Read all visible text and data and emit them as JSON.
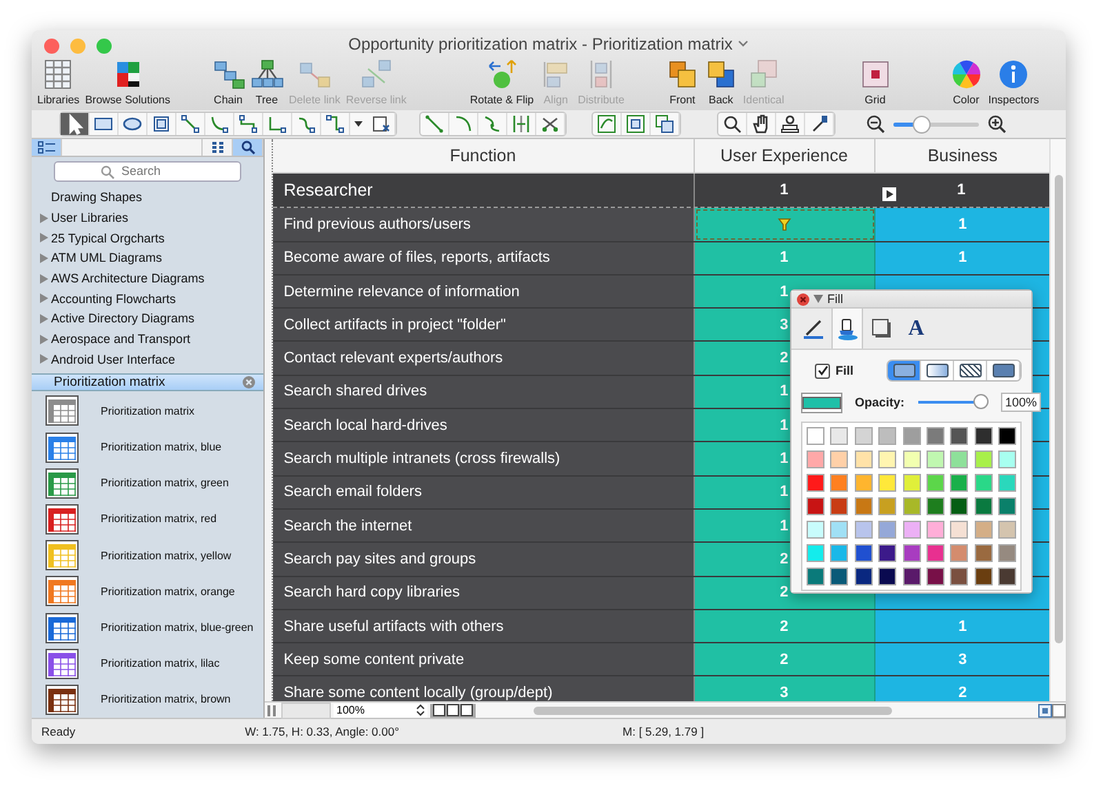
{
  "window": {
    "title": "Opportunity prioritization matrix - Prioritization matrix"
  },
  "toolbar": [
    [
      {
        "label": "Libraries",
        "disabled": false
      },
      {
        "label": "Browse Solutions",
        "disabled": false
      }
    ],
    [
      {
        "label": "Chain",
        "disabled": false
      },
      {
        "label": "Tree",
        "disabled": false
      },
      {
        "label": "Delete link",
        "disabled": true
      },
      {
        "label": "Reverse link",
        "disabled": true
      }
    ],
    [
      {
        "label": "Rotate & Flip",
        "disabled": false
      },
      {
        "label": "Align",
        "disabled": true
      },
      {
        "label": "Distribute",
        "disabled": true
      }
    ],
    [
      {
        "label": "Front",
        "disabled": false
      },
      {
        "label": "Back",
        "disabled": false
      },
      {
        "label": "Identical",
        "disabled": true
      }
    ],
    [
      {
        "label": "Grid",
        "disabled": false
      }
    ],
    [
      {
        "label": "Color",
        "disabled": false
      },
      {
        "label": "Inspectors",
        "disabled": false
      }
    ]
  ],
  "tool_groups": [
    [
      {
        "selected": true
      },
      {
        "selected": false
      },
      {
        "selected": false
      },
      {
        "selected": false
      },
      {
        "selected": false
      },
      {
        "selected": false
      },
      {
        "selected": false
      },
      {
        "selected": false
      },
      {
        "selected": false
      },
      {
        "selected": false
      },
      {
        "selected": false
      }
    ],
    [
      {
        "selected": false
      },
      {
        "selected": false
      },
      {
        "selected": false
      },
      {
        "selected": false
      },
      {
        "selected": false
      }
    ],
    [
      {
        "selected": false
      },
      {
        "selected": false
      },
      {
        "selected": false
      }
    ],
    [
      {
        "selected": false
      },
      {
        "selected": false
      },
      {
        "selected": false
      },
      {
        "selected": false
      }
    ]
  ],
  "zoom_slider": {
    "level": 0.33
  },
  "sidebar": {
    "view_buttons": [
      {
        "selected": true
      },
      {
        "selected": false
      },
      {
        "selected": true
      }
    ],
    "search": {
      "placeholder": "Search"
    },
    "libraries": [
      {
        "label": "Drawing Shapes",
        "expandable": false
      },
      {
        "label": "User Libraries",
        "expandable": true
      },
      {
        "label": "25 Typical Orgcharts",
        "expandable": true
      },
      {
        "label": "ATM UML Diagrams",
        "expandable": true
      },
      {
        "label": "AWS Architecture Diagrams",
        "expandable": true
      },
      {
        "label": "Accounting Flowcharts",
        "expandable": true
      },
      {
        "label": "Active Directory Diagrams",
        "expandable": true
      },
      {
        "label": "Aerospace and Transport",
        "expandable": true
      },
      {
        "label": "Android User Interface",
        "expandable": true
      }
    ],
    "open_library": {
      "title": "Prioritization matrix"
    },
    "shapes": [
      {
        "label": "Prioritization matrix",
        "color": "#8c8c8c"
      },
      {
        "label": "Prioritization matrix, blue",
        "color": "#2a80e8"
      },
      {
        "label": "Prioritization matrix, green",
        "color": "#2a9a48"
      },
      {
        "label": "Prioritization matrix, red",
        "color": "#d82020"
      },
      {
        "label": "Prioritization matrix, yellow",
        "color": "#f0c020"
      },
      {
        "label": "Prioritization matrix, orange",
        "color": "#f07820"
      },
      {
        "label": "Prioritization matrix, blue-green",
        "color": "#1a6ad8"
      },
      {
        "label": "Prioritization matrix, lilac",
        "color": "#8a50e8"
      },
      {
        "label": "Prioritization matrix, brown",
        "color": "#7a3010"
      }
    ]
  },
  "table": {
    "columns": [
      "Function",
      "User Experience",
      "Business"
    ],
    "rows": [
      {
        "kind": "header",
        "function": "Researcher",
        "user_experience": "1",
        "business": "1",
        "selected": false
      },
      {
        "kind": "row",
        "function": "Find previous authors/users",
        "business": "1",
        "selected": true
      },
      {
        "kind": "row",
        "function": "Become aware of files, reports, artifacts",
        "user_experience": "1",
        "business": "1",
        "selected": false
      },
      {
        "kind": "row",
        "function": "Determine relevance of information",
        "user_experience": "1",
        "selected": false
      },
      {
        "kind": "row",
        "function": "Collect artifacts in project \"folder\"",
        "user_experience": "3",
        "selected": false
      },
      {
        "kind": "row",
        "function": "Contact relevant experts/authors",
        "user_experience": "2",
        "selected": false
      },
      {
        "kind": "row",
        "function": "Search shared drives",
        "user_experience": "1",
        "selected": false
      },
      {
        "kind": "row",
        "function": "Search local hard-drives",
        "user_experience": "1",
        "selected": false
      },
      {
        "kind": "row",
        "function": "Search multiple intranets (cross firewalls)",
        "user_experience": "1",
        "selected": false
      },
      {
        "kind": "row",
        "function": "Search email folders",
        "user_experience": "1",
        "selected": false
      },
      {
        "kind": "row",
        "function": "Search the internet",
        "user_experience": "1",
        "selected": false
      },
      {
        "kind": "row",
        "function": "Search pay sites and groups",
        "user_experience": "2",
        "selected": false
      },
      {
        "kind": "row",
        "function": "Search hard copy libraries",
        "user_experience": "2",
        "selected": false
      },
      {
        "kind": "row",
        "function": "Share useful artifacts with others",
        "user_experience": "2",
        "business": "1",
        "selected": false
      },
      {
        "kind": "row",
        "function": "Keep some content private",
        "user_experience": "2",
        "business": "3",
        "selected": false
      },
      {
        "kind": "row",
        "function": "Share some content locally (group/dept)",
        "user_experience": "3",
        "business": "2",
        "selected": false
      }
    ]
  },
  "fill_panel": {
    "title": "Fill",
    "tabs": [
      {
        "selected": false
      },
      {
        "selected": true
      },
      {
        "selected": false
      },
      {
        "selected": false,
        "label": "A"
      }
    ],
    "fill_checked": true,
    "fill_label": "Fill",
    "styles": [
      {
        "selected": true
      },
      {
        "selected": false
      },
      {
        "selected": false
      },
      {
        "selected": false
      }
    ],
    "opacity_label": "Opacity:",
    "opacity": {
      "level": 1.0,
      "reading": "100%"
    },
    "swatches": [
      [
        {
          "color": "#ffffff"
        },
        {
          "color": "#e8e8e8"
        },
        {
          "color": "#d4d4d4"
        },
        {
          "color": "#bdbdbd"
        },
        {
          "color": "#9e9e9e"
        },
        {
          "color": "#7b7b7b"
        },
        {
          "color": "#555555"
        },
        {
          "color": "#2e2e2e"
        },
        {
          "color": "#000000"
        }
      ],
      [
        {
          "color": "#ffa8a8"
        },
        {
          "color": "#ffd0a8"
        },
        {
          "color": "#ffe2a8"
        },
        {
          "color": "#fff5b0"
        },
        {
          "color": "#f2ffb0"
        },
        {
          "color": "#c0f7b0"
        },
        {
          "color": "#8ee09a"
        },
        {
          "color": "#a8f04a"
        },
        {
          "color": "#a8fff0"
        }
      ],
      [
        {
          "color": "#ff1a1a"
        },
        {
          "color": "#ff8020"
        },
        {
          "color": "#ffb52e"
        },
        {
          "color": "#ffe83a"
        },
        {
          "color": "#e0ef3a"
        },
        {
          "color": "#5cd64a"
        },
        {
          "color": "#1ab04a"
        },
        {
          "color": "#2ad888"
        },
        {
          "color": "#2ad8bc"
        }
      ],
      [
        {
          "color": "#c81414"
        },
        {
          "color": "#c83c14"
        },
        {
          "color": "#c87814"
        },
        {
          "color": "#c8a020"
        },
        {
          "color": "#a8b828"
        },
        {
          "color": "#1e7e1e"
        },
        {
          "color": "#055e14"
        },
        {
          "color": "#0a7a40"
        },
        {
          "color": "#0a806a"
        }
      ],
      [
        {
          "color": "#c8fcfc"
        },
        {
          "color": "#a0e0f5"
        },
        {
          "color": "#b8c4ec"
        },
        {
          "color": "#95a8d8"
        },
        {
          "color": "#ecb0f5"
        },
        {
          "color": "#ffaed8"
        },
        {
          "color": "#f5e0d4"
        },
        {
          "color": "#d4ae86"
        },
        {
          "color": "#d4c4ae"
        }
      ],
      [
        {
          "color": "#14ecec"
        },
        {
          "color": "#1ab8e8"
        },
        {
          "color": "#2050d0"
        },
        {
          "color": "#3c1a8a"
        },
        {
          "color": "#a83cc0"
        },
        {
          "color": "#e83090"
        },
        {
          "color": "#d48c6e"
        },
        {
          "color": "#9a6a40"
        },
        {
          "color": "#968a80"
        }
      ],
      [
        {
          "color": "#0a7a7a"
        },
        {
          "color": "#0a5a78"
        },
        {
          "color": "#0a2880"
        },
        {
          "color": "#0a0a50"
        },
        {
          "color": "#5a1a6a"
        },
        {
          "color": "#781048"
        },
        {
          "color": "#7a5040"
        },
        {
          "color": "#6a3e10"
        },
        {
          "color": "#4a3a32"
        }
      ]
    ]
  },
  "bottom_bar": {
    "zoom": "100%"
  },
  "status_bar": {
    "state": "Ready",
    "geometry": "W: 1.75,  H: 0.33,  Angle: 0.00°",
    "mouse": "M: [ 5.29, 1.79 ]"
  }
}
